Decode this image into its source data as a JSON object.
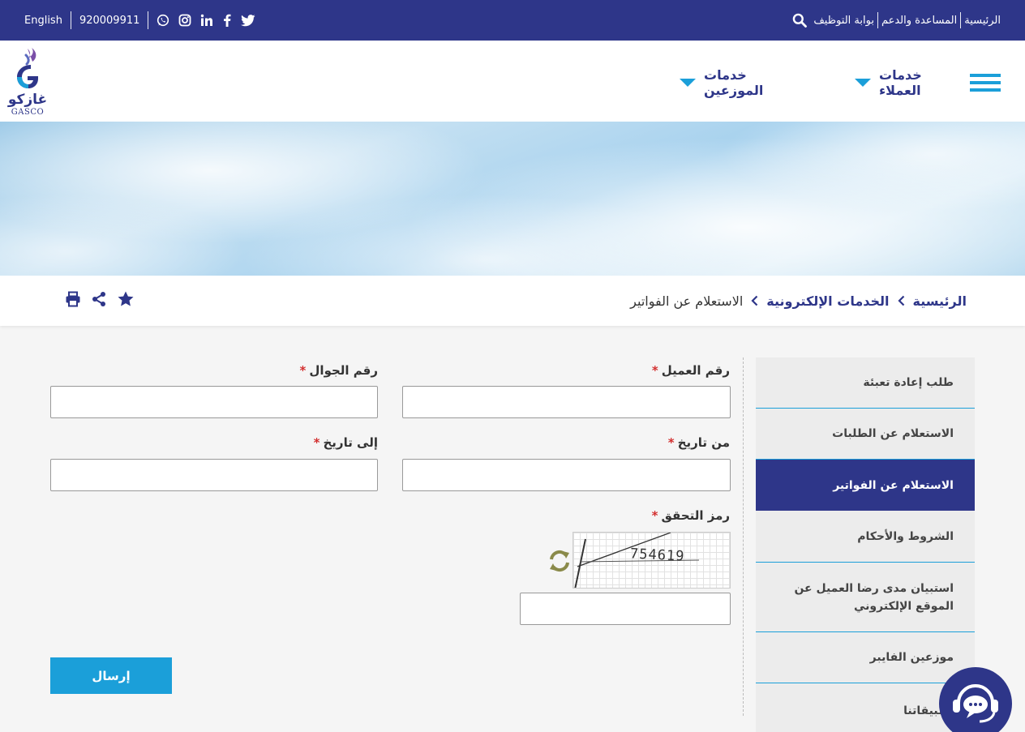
{
  "topbar": {
    "language": "English",
    "phone": "920009911",
    "links": [
      "الرئيسية",
      "المساعدة والدعم",
      "بوابة التوظيف"
    ],
    "social_icons": [
      "whatsapp-icon",
      "instagram-icon",
      "linkedin-icon",
      "facebook-icon",
      "twitter-icon"
    ]
  },
  "header": {
    "logo_ar": "غازكو",
    "logo_en": "GASCO",
    "nav": [
      "خدمات العملاء",
      "خدمات الموزعين"
    ]
  },
  "breadcrumb": {
    "items": [
      "الرئيسية",
      "الخدمات الإلكترونية",
      "الاستعلام عن الفواتير"
    ]
  },
  "sidebar": {
    "items": [
      {
        "label": "طلب إعادة تعبئة",
        "active": false
      },
      {
        "label": "الاستعلام عن الطلبات",
        "active": false
      },
      {
        "label": "الاستعلام عن الفواتير",
        "active": true
      },
      {
        "label": "الشروط والأحكام",
        "active": false
      },
      {
        "label": "استبيان مدى رضا العميل عن الموقع الإلكتروني",
        "active": false
      },
      {
        "label": "موزعين الفايبر",
        "active": false
      },
      {
        "label": "تطبيقاتنا",
        "active": false
      }
    ]
  },
  "form": {
    "customer_number_label": "رقم العميل",
    "mobile_label": "رقم الجوال",
    "from_date_label": "من تاريخ",
    "to_date_label": "إلى تاريخ",
    "captcha_label": "رمز التحقق",
    "required_mark": "*",
    "customer_number_value": "",
    "mobile_value": "",
    "from_date_value": "",
    "to_date_value": "",
    "captcha_value": "",
    "captcha_text": "754619",
    "submit_label": "إرسال"
  },
  "colors": {
    "primary": "#2e3689",
    "accent": "#1b9fd9",
    "required": "#d32f2f"
  }
}
